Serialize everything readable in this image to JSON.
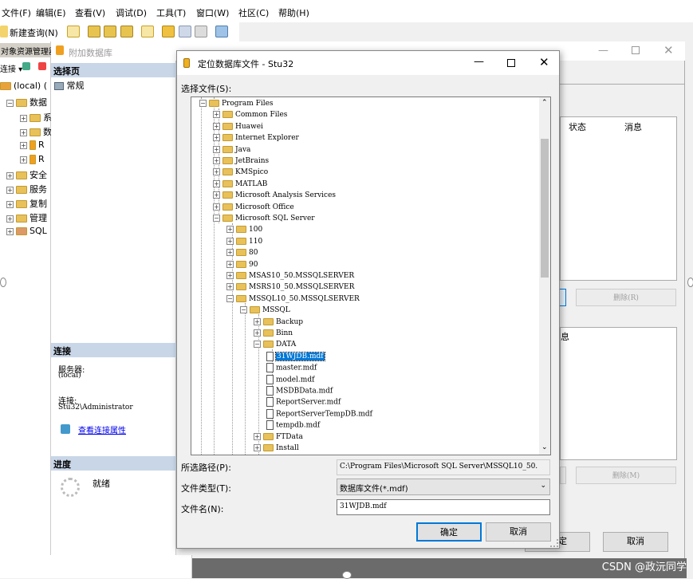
{
  "main": {
    "menu": [
      "文件(F)",
      "编辑(E)",
      "查看(V)",
      "调试(D)",
      "工具(T)",
      "窗口(W)",
      "社区(C)",
      "帮助(H)"
    ],
    "new_query": "新建查询(N)"
  },
  "object_explorer": {
    "title": "对象资源管理器",
    "connect": "连接 ▾",
    "server": "(local) (",
    "nodes": [
      "数据",
      "系",
      "数",
      "R",
      "R",
      "安全",
      "服务",
      "复制",
      "管理",
      "SQL"
    ]
  },
  "attach_dialog": {
    "title": "附加数据库",
    "select_page": "选择页",
    "general": "常规",
    "connection_head": "连接",
    "server_label": "服务器:",
    "server_value": "(local)",
    "connection_label": "连接:",
    "connection_value": "Stu32\\Administrator",
    "view_conn_props": "查看连接属性",
    "progress_head": "进度",
    "progress_status": "就绪",
    "col_status": "状态",
    "col_message": "消息",
    "details_tail": "息",
    "remove_r": "删除(R)",
    "remove_m": "删除(M)",
    "ok_tail": "定",
    "cancel": "取消"
  },
  "locate_dialog": {
    "title": "定位数据库文件 - Stu32",
    "select_file_label": "选择文件(S):",
    "tree": [
      {
        "label": "Program Files",
        "type": "folder",
        "expanded": true
      },
      {
        "label": "Common Files",
        "type": "folder"
      },
      {
        "label": "Huawei",
        "type": "folder"
      },
      {
        "label": "Internet Explorer",
        "type": "folder"
      },
      {
        "label": "Java",
        "type": "folder"
      },
      {
        "label": "JetBrains",
        "type": "folder"
      },
      {
        "label": "KMSpico",
        "type": "folder"
      },
      {
        "label": "MATLAB",
        "type": "folder"
      },
      {
        "label": "Microsoft Analysis Services",
        "type": "folder"
      },
      {
        "label": "Microsoft Office",
        "type": "folder"
      },
      {
        "label": "Microsoft SQL Server",
        "type": "folder",
        "expanded": true
      },
      {
        "label": "100",
        "type": "folder"
      },
      {
        "label": "110",
        "type": "folder"
      },
      {
        "label": "80",
        "type": "folder"
      },
      {
        "label": "90",
        "type": "folder"
      },
      {
        "label": "MSAS10_50.MSSQLSERVER",
        "type": "folder"
      },
      {
        "label": "MSRS10_50.MSSQLSERVER",
        "type": "folder"
      },
      {
        "label": "MSSQL10_50.MSSQLSERVER",
        "type": "folder",
        "expanded": true
      },
      {
        "label": "MSSQL",
        "type": "folder",
        "expanded": true
      },
      {
        "label": "Backup",
        "type": "folder"
      },
      {
        "label": "Binn",
        "type": "folder"
      },
      {
        "label": "DATA",
        "type": "folder",
        "expanded": true
      },
      {
        "label": "31WJDB.mdf",
        "type": "file",
        "selected": true
      },
      {
        "label": "master.mdf",
        "type": "file"
      },
      {
        "label": "model.mdf",
        "type": "file"
      },
      {
        "label": "MSDBData.mdf",
        "type": "file"
      },
      {
        "label": "ReportServer.mdf",
        "type": "file"
      },
      {
        "label": "ReportServerTempDB.mdf",
        "type": "file"
      },
      {
        "label": "tempdb.mdf",
        "type": "file"
      },
      {
        "label": "FTData",
        "type": "folder"
      },
      {
        "label": "Install",
        "type": "folder"
      }
    ],
    "selected_path_label": "所选路径(P):",
    "selected_path_value": "C:\\Program Files\\Microsoft SQL Server\\MSSQL10_50.",
    "file_type_label": "文件类型(T):",
    "file_type_value": "数据库文件(*.mdf)",
    "file_name_label": "文件名(N):",
    "file_name_value": "31WJDB.mdf",
    "ok": "确定",
    "cancel": "取消"
  },
  "watermark": "CSDN @政沅同学",
  "colors": {
    "selection": "#0078d7",
    "section_header": "#c9d6e8",
    "link": "#0000ee"
  }
}
